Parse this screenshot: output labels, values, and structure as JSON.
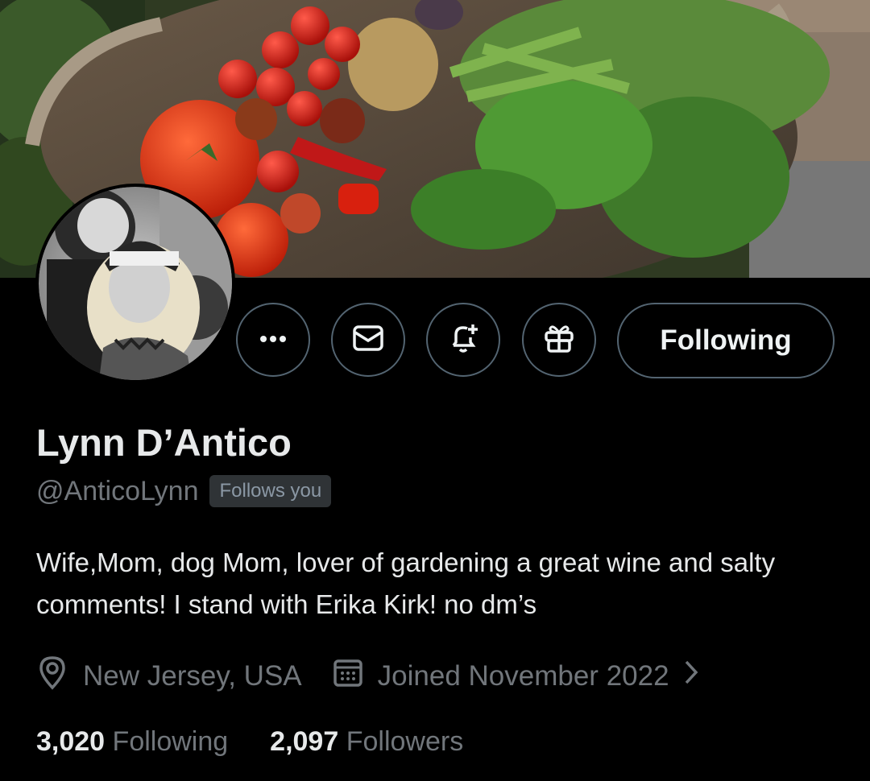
{
  "profile": {
    "name": "Lynn D’Antico",
    "handle": "@AnticoLynn",
    "follows_you_badge": "Follows you",
    "bio": "Wife,Mom, dog Mom, lover of gardening a great wine and salty comments! I stand with Erika Kirk! no dm’s",
    "location": "New Jersey, USA",
    "joined": "Joined November 2022"
  },
  "actions": {
    "following_label": "Following",
    "icons": [
      "more-icon",
      "message-icon",
      "notify-bell-icon",
      "gift-icon"
    ]
  },
  "stats": {
    "following_count": "3,020",
    "following_label": "Following",
    "followers_count": "2,097",
    "followers_label": "Followers"
  },
  "colors": {
    "background": "#000000",
    "text_primary": "#e7e9ea",
    "text_secondary": "#71767b",
    "border": "#536471"
  }
}
